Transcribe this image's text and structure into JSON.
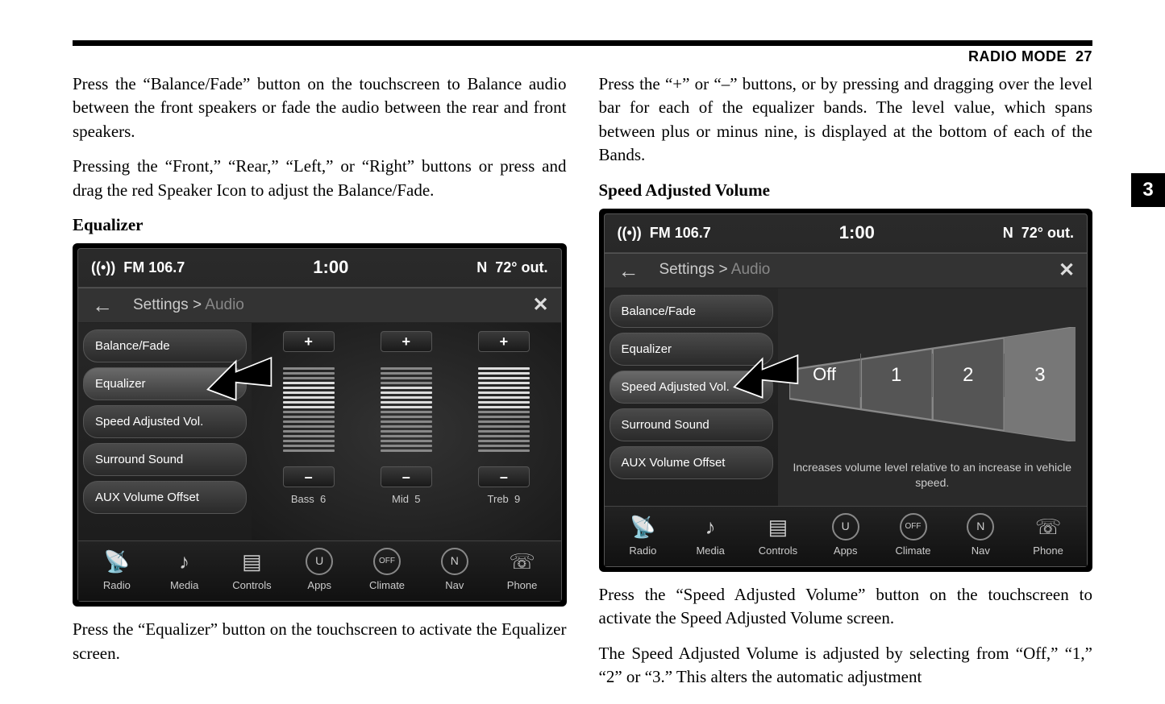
{
  "header": {
    "section": "RADIO MODE",
    "page_num": "27",
    "chapter_tab": "3"
  },
  "left": {
    "p1": "Press the “Balance/Fade” button on the touchscreen to Balance audio between the front speakers or fade the audio between the rear and front speakers.",
    "p2": "Pressing the “Front,” “Rear,” “Left,” or “Right” buttons or press and drag the red Speaker Icon to adjust the Balance/Fade.",
    "h_eq": "Equalizer",
    "p3": "Press the “Equalizer” button on the touchscreen to activate the Equalizer screen."
  },
  "right": {
    "p1": "Press the “+” or “–” buttons, or by pressing and dragging over the level bar for each of the equalizer bands. The level value, which spans between plus or minus nine, is displayed at the bottom of each of the Bands.",
    "h_sav": "Speed Adjusted Volume",
    "p2": "Press the “Speed Adjusted Volume” button on the touchscreen to activate the Speed Adjusted Volume screen.",
    "p3": "The Speed Adjusted Volume is adjusted by selecting from “Off,” “1,” “2” or “3.” This alters the automatic adjustment"
  },
  "screen": {
    "status": {
      "station": "FM 106.7",
      "time": "1:00",
      "compass": "N",
      "temp": "72° out."
    },
    "breadcrumb": {
      "root": "Settings",
      "sep": ">",
      "current": "Audio"
    },
    "radio_icon": "((·))",
    "side_items": [
      "Balance/Fade",
      "Equalizer",
      "Speed Adjusted Vol.",
      "Surround Sound",
      "AUX Volume Offset"
    ],
    "eq": {
      "bands": [
        {
          "label": "Bass",
          "value": "6"
        },
        {
          "label": "Mid",
          "value": "5"
        },
        {
          "label": "Treb",
          "value": "9"
        }
      ],
      "plus": "+",
      "minus": "–"
    },
    "sav": {
      "options": [
        "Off",
        "1",
        "2",
        "3"
      ],
      "caption": "Increases volume level relative to an increase in vehicle speed."
    },
    "nav": [
      {
        "label": "Radio",
        "glyph": "Å"
      },
      {
        "label": "Media",
        "glyph": "♪"
      },
      {
        "label": "Controls",
        "glyph": "☰"
      },
      {
        "label": "Apps",
        "glyph": "U"
      },
      {
        "label": "Climate",
        "glyph": "OFF"
      },
      {
        "label": "Nav",
        "glyph": "N"
      },
      {
        "label": "Phone",
        "glyph": "••"
      }
    ]
  }
}
